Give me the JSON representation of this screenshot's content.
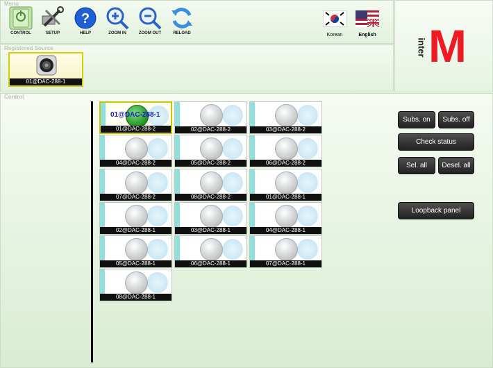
{
  "menu": {
    "title": "Menu",
    "buttons": [
      {
        "label": "CONTROL",
        "icon": "control-icon"
      },
      {
        "label": "SETUP",
        "icon": "setup-tools-icon"
      },
      {
        "label": "HELP",
        "icon": "help-icon"
      },
      {
        "label": "ZOOM IN",
        "icon": "zoom-in-icon"
      },
      {
        "label": "ZOOM OUT",
        "icon": "zoom-out-icon"
      },
      {
        "label": "RELOAD",
        "icon": "reload-icon"
      }
    ],
    "languages": [
      {
        "label": "Korean",
        "icon": "korean-flag-icon"
      },
      {
        "label": "English",
        "icon": "english-flag-icon"
      }
    ]
  },
  "registered": {
    "title": "Registered Source",
    "source_label": "01@DAC-288-1",
    "icon": "speaker-icon"
  },
  "logo": {
    "letter": "M",
    "text": "inter",
    "accent": "#ee1b24"
  },
  "control": {
    "title": "Control",
    "selected_name": "01@DAC-288-1",
    "tiles": [
      "01@DAC-288-2",
      "02@DAC-288-2",
      "03@DAC-288-2",
      "04@DAC-288-2",
      "05@DAC-288-2",
      "06@DAC-288-2",
      "07@DAC-288-2",
      "08@DAC-288-2",
      "01@DAC-288-1",
      "02@DAC-288-1",
      "03@DAC-288-1",
      "04@DAC-288-1",
      "05@DAC-288-1",
      "06@DAC-288-1",
      "07@DAC-288-1",
      "08@DAC-288-1"
    ],
    "buttons": {
      "subs_on": "Subs. on",
      "subs_off": "Subs. off",
      "check_status": "Check status",
      "sel_all": "Sel. all",
      "desel_all": "Desel. all",
      "loopback": "Loopback panel"
    }
  }
}
